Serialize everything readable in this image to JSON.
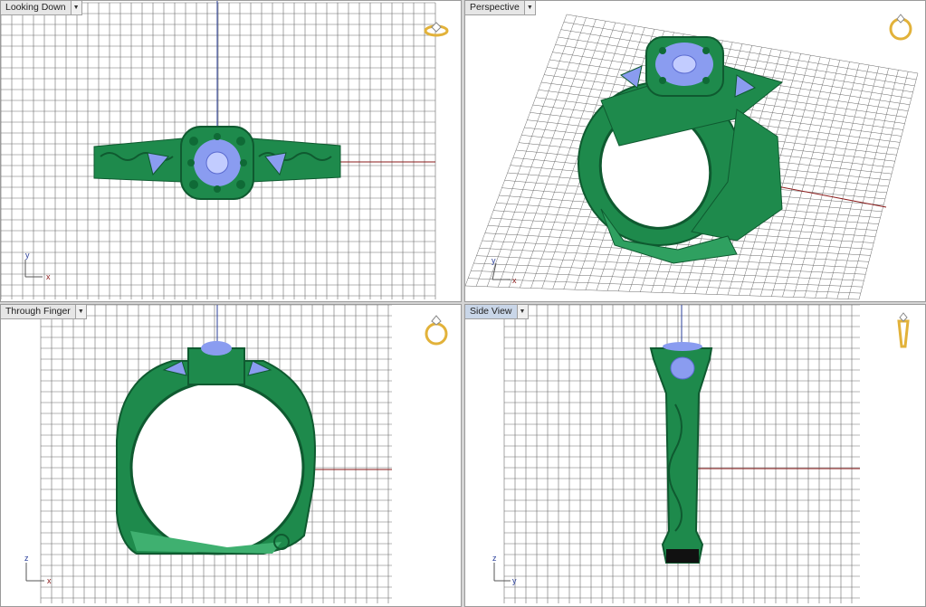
{
  "viewports": [
    {
      "id": "looking-down",
      "label": "Looking Down",
      "active": false,
      "axis_labels": [
        "y",
        "x"
      ],
      "badge_icon": "ring-side-icon"
    },
    {
      "id": "perspective",
      "label": "Perspective",
      "active": false,
      "axis_labels": [
        "y",
        "x"
      ],
      "badge_icon": "ring-perspective-icon"
    },
    {
      "id": "through-finger",
      "label": "Through Finger",
      "active": false,
      "axis_labels": [
        "z",
        "x"
      ],
      "badge_icon": "ring-front-icon"
    },
    {
      "id": "side-view",
      "label": "Side View",
      "active": true,
      "axis_labels": [
        "z",
        "y"
      ],
      "badge_icon": "ring-profile-icon"
    }
  ],
  "colors": {
    "ring": "#1e8a4c",
    "ring_dark": "#0f5a30",
    "gem": "#8a9cf0",
    "gem_light": "#c2ccff",
    "grid": "#6a6a6a",
    "axis_x": "#8a1a1a",
    "axis_y": "#2a3f9a",
    "badge_gold": "#e2b23a"
  }
}
